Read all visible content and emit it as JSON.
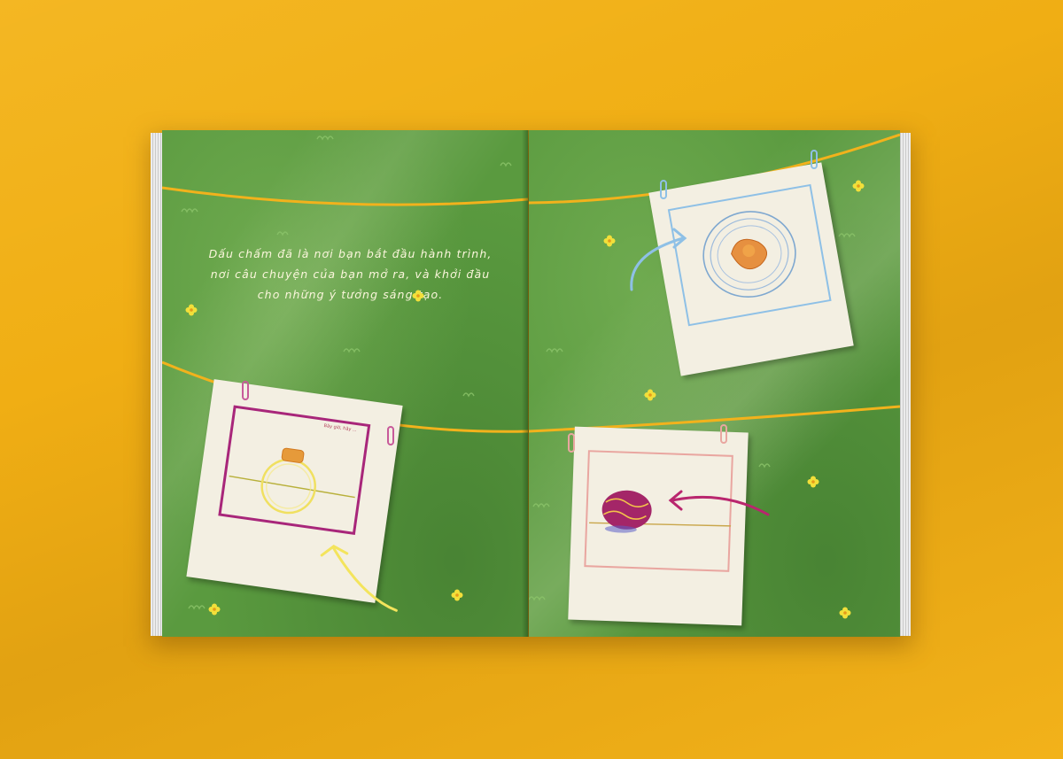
{
  "scene": {
    "background_color": "#f0ae14",
    "page_color": "#5a9a3f",
    "rope_color": "#f2b21c"
  },
  "left_page": {
    "intro_text": "Dấu chấm đã là nơi bạn bắt đầu hành trình, nơi câu chuyện của bạn mở ra, và khởi đầu cho những ý tưởng sáng tạo.",
    "photo_jar": {
      "caption": "Bây giờ, hãy ... ",
      "frame_color": "#a8267a",
      "arrow_color": "#f3e45c",
      "clip_color": "#c85a9a"
    }
  },
  "right_page": {
    "photo_plate": {
      "caption": "",
      "frame_color": "#8ec0e6",
      "arrow_color": "#8ec0e6",
      "clip_color": "#8ec0e6"
    },
    "photo_ball": {
      "caption": "",
      "frame_color": "#e9a6a0",
      "arrow_color": "#b9266e",
      "clip_color": "#e9a6a0"
    }
  },
  "icons": [
    "flower-icon",
    "arrow-icon",
    "clip-icon"
  ]
}
